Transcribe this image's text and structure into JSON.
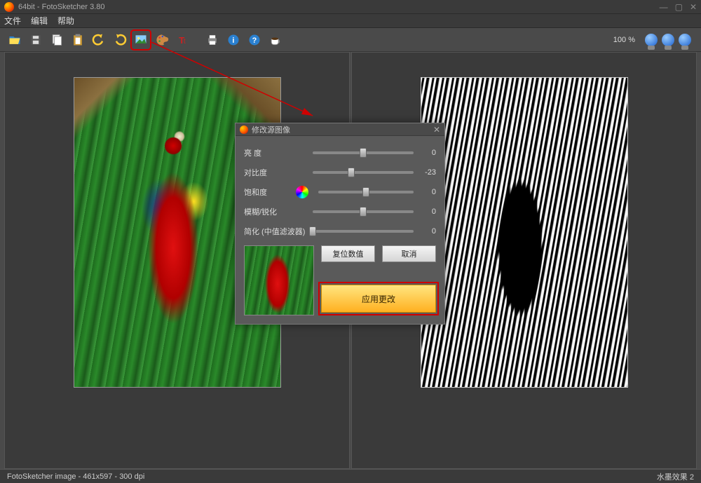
{
  "titlebar": {
    "title": "64bit - FotoSketcher 3.80"
  },
  "menubar": {
    "file": "文件",
    "edit": "编辑",
    "help": "帮助"
  },
  "toolbar": {
    "zoom": "100 %"
  },
  "dialog": {
    "title": "修改源图像",
    "sliders": {
      "brightness": {
        "label": "亮 度",
        "value": "0",
        "pos": 50
      },
      "contrast": {
        "label": "对比度",
        "value": "-23",
        "pos": 38
      },
      "saturation": {
        "label": "饱和度",
        "value": "0",
        "pos": 50
      },
      "blur": {
        "label": "模糊/锐化",
        "value": "0",
        "pos": 50
      },
      "simplify": {
        "label": "简化 (中值滤波器)",
        "value": "0",
        "pos": 0
      }
    },
    "buttons": {
      "reset": "复位数值",
      "cancel": "取消",
      "apply": "应用更改"
    }
  },
  "statusbar": {
    "left": "FotoSketcher image - 461x597 - 300 dpi",
    "right": "水墨效果 2"
  }
}
